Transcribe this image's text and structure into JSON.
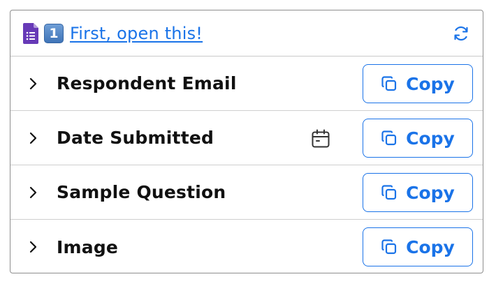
{
  "header": {
    "badge": "1",
    "link_text": "First, open this!",
    "badge_icon": "keycap-one-icon",
    "forms_icon": "google-forms-icon",
    "refresh_icon": "refresh-icon"
  },
  "rows": [
    {
      "label": "Respondent Email",
      "copy_label": "Copy",
      "has_calendar": false
    },
    {
      "label": "Date Submitted",
      "copy_label": "Copy",
      "has_calendar": true
    },
    {
      "label": "Sample Question",
      "copy_label": "Copy",
      "has_calendar": false
    },
    {
      "label": "Image",
      "copy_label": "Copy",
      "has_calendar": false
    }
  ],
  "colors": {
    "accent": "#1a73e8",
    "forms_purple": "#673ab7",
    "border": "#8e8e8e",
    "text": "#111111"
  }
}
